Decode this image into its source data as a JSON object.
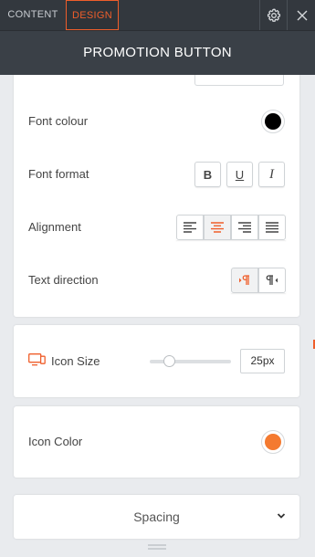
{
  "tabs": [
    {
      "label": "CONTENT",
      "active": false
    },
    {
      "label": "DESIGN",
      "active": true
    }
  ],
  "header": {
    "title": "PROMOTION BUTTON"
  },
  "typography": {
    "font_colour_label": "Font colour",
    "font_colour": "#000000",
    "font_format_label": "Font format",
    "font_format_buttons": [
      {
        "name": "bold",
        "label": "B"
      },
      {
        "name": "underline",
        "label": "U"
      },
      {
        "name": "italic",
        "label": "I"
      }
    ],
    "alignment_label": "Alignment",
    "alignment_options": [
      "left",
      "center",
      "right",
      "justify"
    ],
    "alignment_selected": "center",
    "text_direction_label": "Text direction",
    "text_direction_options": [
      "ltr",
      "rtl"
    ],
    "text_direction_selected": "ltr"
  },
  "icon_size": {
    "label": "Icon Size",
    "value": "25px",
    "slider_fraction": 0.24
  },
  "icon_color": {
    "label": "Icon Color",
    "color": "#f47a30"
  },
  "spacing": {
    "label": "Spacing"
  },
  "colors": {
    "accent": "#ef5e2b",
    "dark_bar": "#33383e"
  }
}
